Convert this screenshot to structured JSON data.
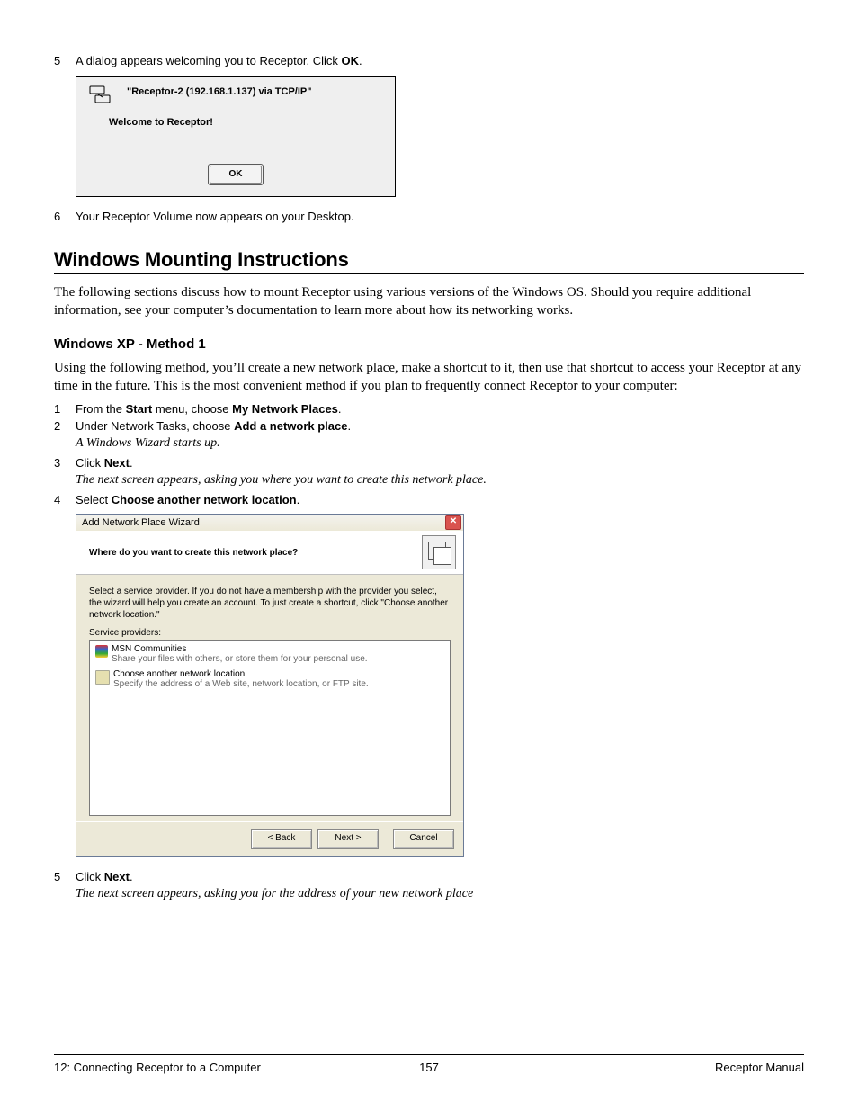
{
  "steps_a": {
    "s5": {
      "num": "5",
      "pre": "A dialog appears welcoming you to Receptor. Click ",
      "b": "OK",
      "post": "."
    },
    "s6": {
      "num": "6",
      "text": "Your Receptor Volume now appears on your Desktop."
    }
  },
  "dialog1": {
    "network": "\"Receptor-2 (192.168.1.137) via TCP/IP\"",
    "welcome": "Welcome to Receptor!",
    "ok": "OK"
  },
  "heading1": "Windows Mounting Instructions",
  "intro": "The following sections discuss how to mount Receptor using various versions of the Windows OS. Should you require additional information, see your computer’s documentation to learn more about how its networking works.",
  "heading2": "Windows XP - Method 1",
  "intro2": "Using the following method, you’ll create a new network place, make a shortcut to it, then use that shortcut to access your Receptor at any time in the future. This is the most convenient method if you plan to frequently connect Receptor to your computer:",
  "steps_b": {
    "s1": {
      "num": "1",
      "p1": "From the ",
      "b1": "Start",
      "p2": " menu, choose ",
      "b2": "My Network Places",
      "p3": "."
    },
    "s2": {
      "num": "2",
      "p1": "Under Network Tasks, choose ",
      "b1": "Add a network place",
      "p2": ".",
      "note": "A Windows Wizard starts up."
    },
    "s3": {
      "num": "3",
      "p1": "Click ",
      "b1": "Next",
      "p2": ".",
      "note": "The next screen appears, asking you where you want to create this network place."
    },
    "s4": {
      "num": "4",
      "p1": "Select ",
      "b1": "Choose another network location",
      "p2": "."
    },
    "s5": {
      "num": "5",
      "p1": "Click ",
      "b1": "Next",
      "p2": ".",
      "note": "The next screen appears, asking you for the address of your new network place"
    }
  },
  "wizard": {
    "title": "Add Network Place Wizard",
    "question": "Where do you want to create this network place?",
    "desc": "Select a service provider. If you do not have a membership with the provider you select, the wizard will help you create an account. To just create a shortcut, click \"Choose another network location.\"",
    "sp_label": "Service providers:",
    "items": [
      {
        "t1": "MSN Communities",
        "t2": "Share your files with others, or store them for your personal use.",
        "icon": "msn"
      },
      {
        "t1": "Choose another network location",
        "t2": "Specify the address of a Web site, network location, or FTP site.",
        "icon": "folder"
      }
    ],
    "back": "< Back",
    "next": "Next >",
    "cancel": "Cancel"
  },
  "footer": {
    "left": "12: Connecting Receptor to a Computer",
    "center": "157",
    "right": "Receptor Manual"
  }
}
